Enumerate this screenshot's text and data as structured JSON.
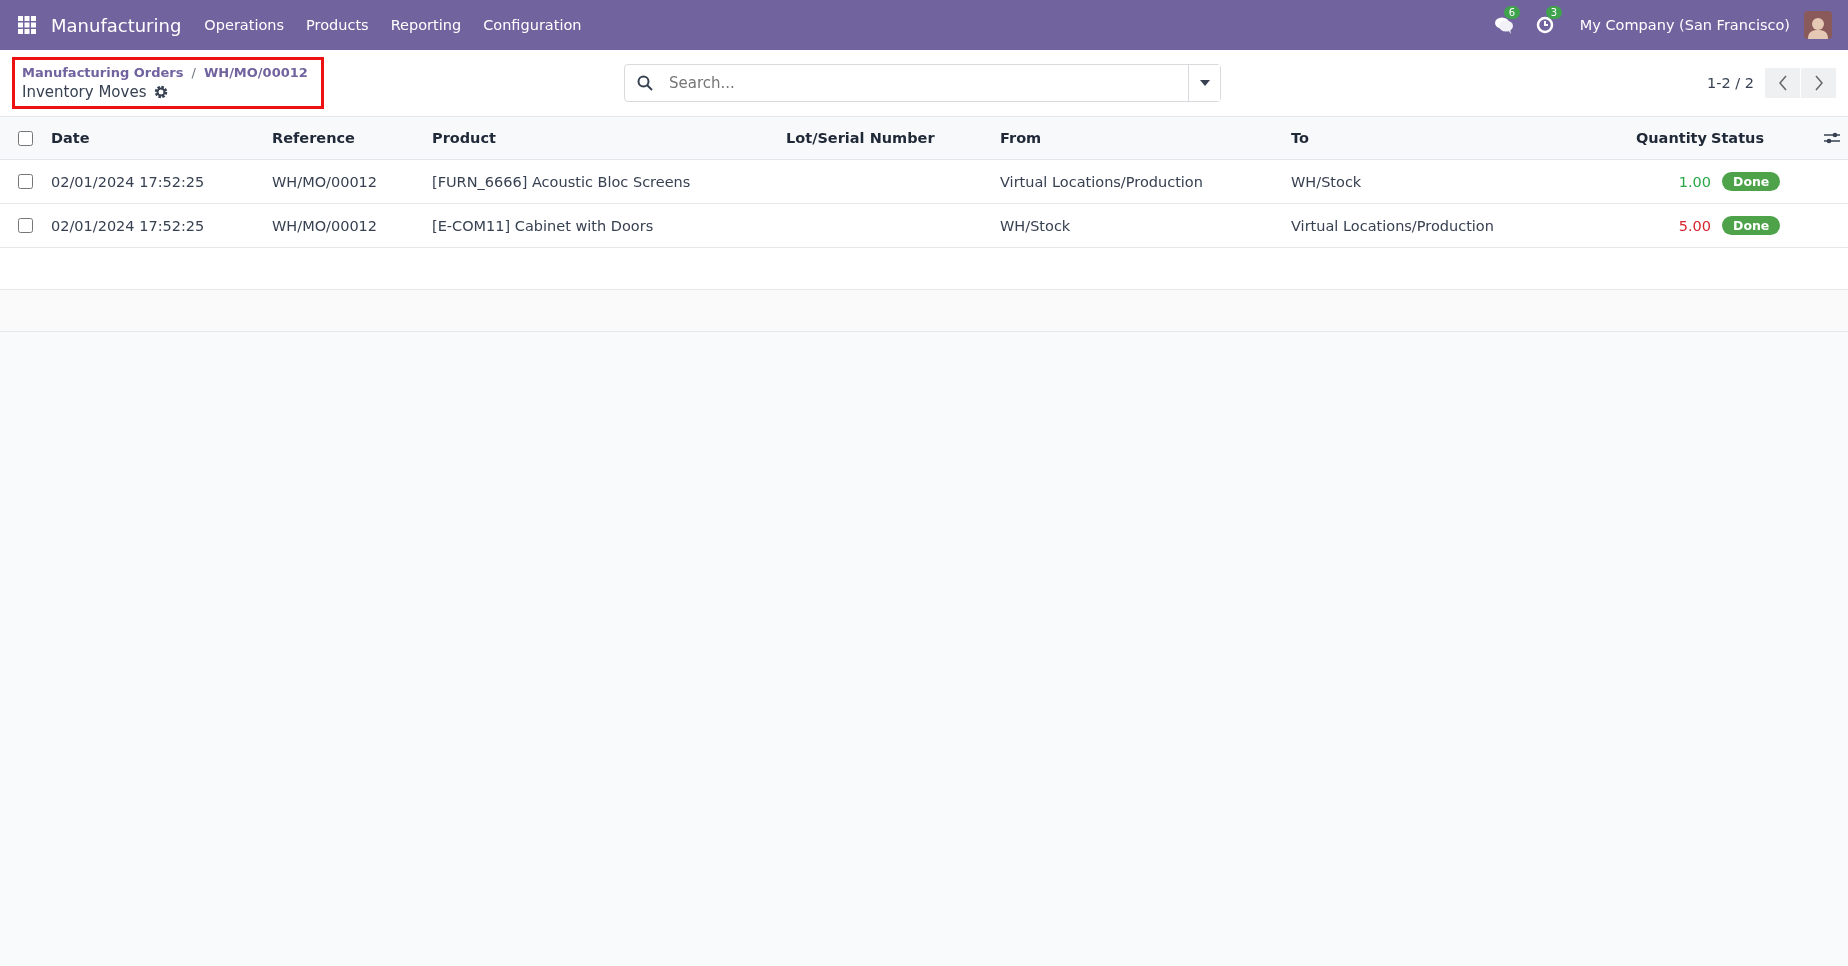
{
  "navbar": {
    "app_name": "Manufacturing",
    "menu": [
      "Operations",
      "Products",
      "Reporting",
      "Configuration"
    ],
    "messages_count": "6",
    "activities_count": "3",
    "company": "My Company (San Francisco)"
  },
  "breadcrumb": {
    "items": [
      "Manufacturing Orders",
      "WH/MO/00012"
    ],
    "separator": "/",
    "current": "Inventory Moves",
    "highlighted": true
  },
  "search": {
    "placeholder": "Search..."
  },
  "pager": {
    "text": "1-2 / 2"
  },
  "table": {
    "columns": [
      "Date",
      "Reference",
      "Product",
      "Lot/Serial Number",
      "From",
      "To",
      "Quantity",
      "Status"
    ],
    "all_checked": false,
    "rows": [
      {
        "checked": false,
        "date": "02/01/2024 17:52:25",
        "reference": "WH/MO/00012",
        "product": "[FURN_6666] Acoustic Bloc Screens",
        "from": "Virtual Locations/Production",
        "to": "WH/Stock",
        "quantity": "1.00",
        "color": "#28a745",
        "status": "Done"
      },
      {
        "checked": false,
        "date": "02/01/2024 17:52:25",
        "reference": "WH/MO/00012",
        "product": "[E-COM11] Cabinet with Doors",
        "from": "WH/Stock",
        "to": "Virtual Locations/Production",
        "quantity": "5.00",
        "color": "#d9232d",
        "status": "Done"
      }
    ]
  }
}
